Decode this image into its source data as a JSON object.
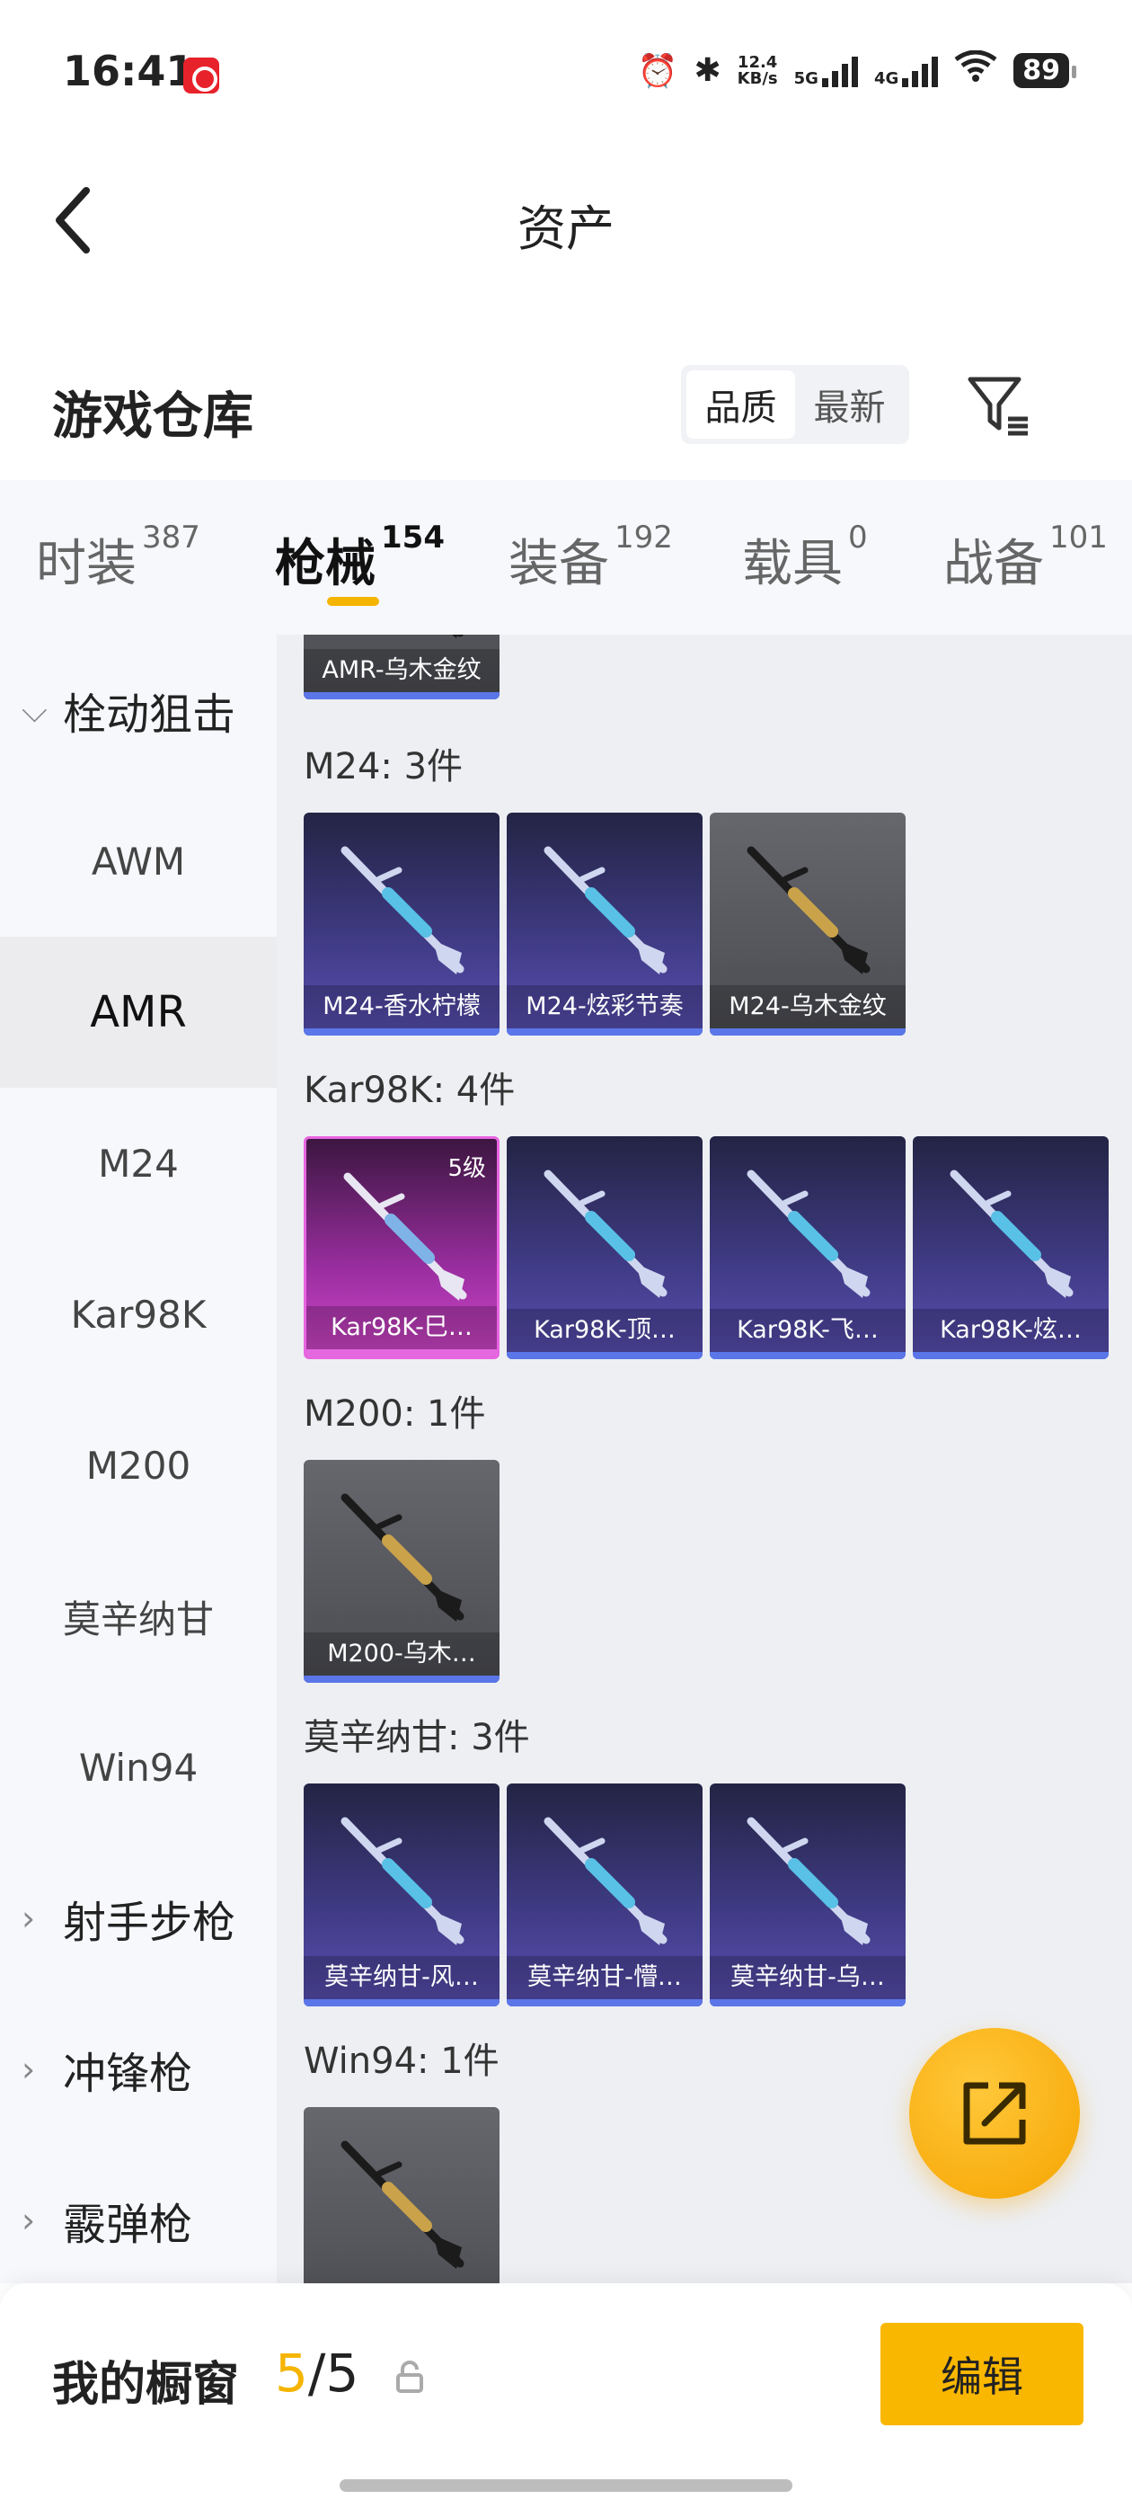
{
  "status_bar": {
    "time": "16:41",
    "net_speed_top": "12.4",
    "net_speed_bottom": "KB/s",
    "sig1": "5G",
    "sig2": "4G",
    "battery": "89"
  },
  "header": {
    "title": "资产"
  },
  "warehouse": {
    "title": "游戏仓库",
    "sort_options": [
      "品质",
      "最新"
    ],
    "sort_selected": "品质"
  },
  "tabs": [
    {
      "label": "时装",
      "count": "387"
    },
    {
      "label": "枪械",
      "count": "154",
      "active": true
    },
    {
      "label": "装备",
      "count": "192"
    },
    {
      "label": "载具",
      "count": "0"
    },
    {
      "label": "战备",
      "count": "101"
    }
  ],
  "sidebar": {
    "categories": [
      {
        "label": "栓动狙击",
        "expanded": true
      },
      {
        "label": "AWM"
      },
      {
        "label": "AMR",
        "active": true
      },
      {
        "label": "M24"
      },
      {
        "label": "Kar98K"
      },
      {
        "label": "M200"
      },
      {
        "label": "莫辛纳甘"
      },
      {
        "label": "Win94"
      },
      {
        "label": "射手步枪",
        "expanded": false
      },
      {
        "label": "冲锋枪",
        "expanded": false
      },
      {
        "label": "霰弹枪",
        "expanded": false
      }
    ]
  },
  "groups": [
    {
      "label": "",
      "items": [
        {
          "name": "AMR-乌木金纹",
          "rarity": "grey"
        }
      ]
    },
    {
      "label": "M24: 3件",
      "items": [
        {
          "name": "M24-香水柠檬",
          "rarity": "purple"
        },
        {
          "name": "M24-炫彩节奏",
          "rarity": "purple"
        },
        {
          "name": "M24-乌木金纹",
          "rarity": "grey"
        }
      ]
    },
    {
      "label": "Kar98K: 4件",
      "items": [
        {
          "name": "Kar98K-巳…",
          "rarity": "pink",
          "level": "5级"
        },
        {
          "name": "Kar98K-顶…",
          "rarity": "purple"
        },
        {
          "name": "Kar98K-飞…",
          "rarity": "purple"
        },
        {
          "name": "Kar98K-炫…",
          "rarity": "purple"
        }
      ]
    },
    {
      "label": "M200: 1件",
      "items": [
        {
          "name": "M200-乌木…",
          "rarity": "grey"
        }
      ]
    },
    {
      "label": "莫辛纳甘: 3件",
      "items": [
        {
          "name": "莫辛纳甘-风…",
          "rarity": "purple"
        },
        {
          "name": "莫辛纳甘-懵…",
          "rarity": "purple"
        },
        {
          "name": "莫辛纳甘-乌…",
          "rarity": "purple"
        }
      ]
    },
    {
      "label": "Win94: 1件",
      "items": [
        {
          "name": "",
          "rarity": "grey"
        }
      ]
    }
  ],
  "showcase": {
    "title": "我的橱窗",
    "current": "5",
    "total": "/5",
    "edit_label": "编辑"
  },
  "colors": {
    "accent": "#f5b400",
    "rare_blue": "#5a76e8",
    "rare_pink": "#e468e0"
  }
}
